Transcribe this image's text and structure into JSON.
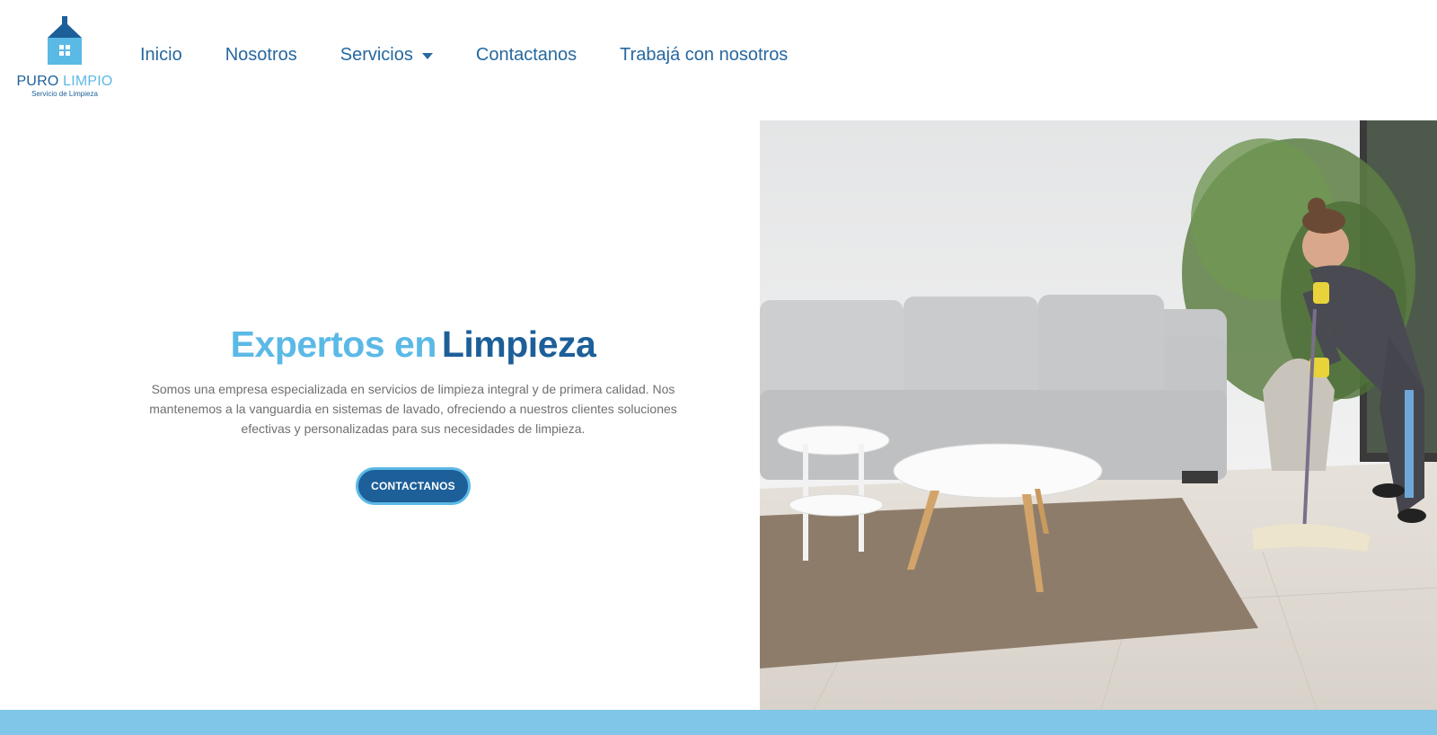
{
  "brand": {
    "name_part1": "PURO",
    "name_part2": "LIMPIO",
    "tagline": "Servicio de Limpieza",
    "colors": {
      "dark": "#1d5f99",
      "light": "#5bb9e6"
    }
  },
  "nav": {
    "items": [
      {
        "label": "Inicio"
      },
      {
        "label": "Nosotros"
      },
      {
        "label": "Servicios",
        "has_dropdown": true
      },
      {
        "label": "Contactanos"
      },
      {
        "label": "Trabajá con nosotros"
      }
    ],
    "color": "#27689f"
  },
  "hero": {
    "title_part1": "Expertos en",
    "title_part2": "Limpieza",
    "description": "Somos una empresa especializada en servicios de limpieza integral y de primera calidad. Nos mantenemos a la vanguardia en sistemas de lavado, ofreciendo a nuestros clientes soluciones efectivas y personalizadas para sus necesidades de limpieza.",
    "cta_label": "CONTACTANOS",
    "image_icon": "living-room-cleaning-photo"
  },
  "footer_band_color": "#7fc6e8"
}
